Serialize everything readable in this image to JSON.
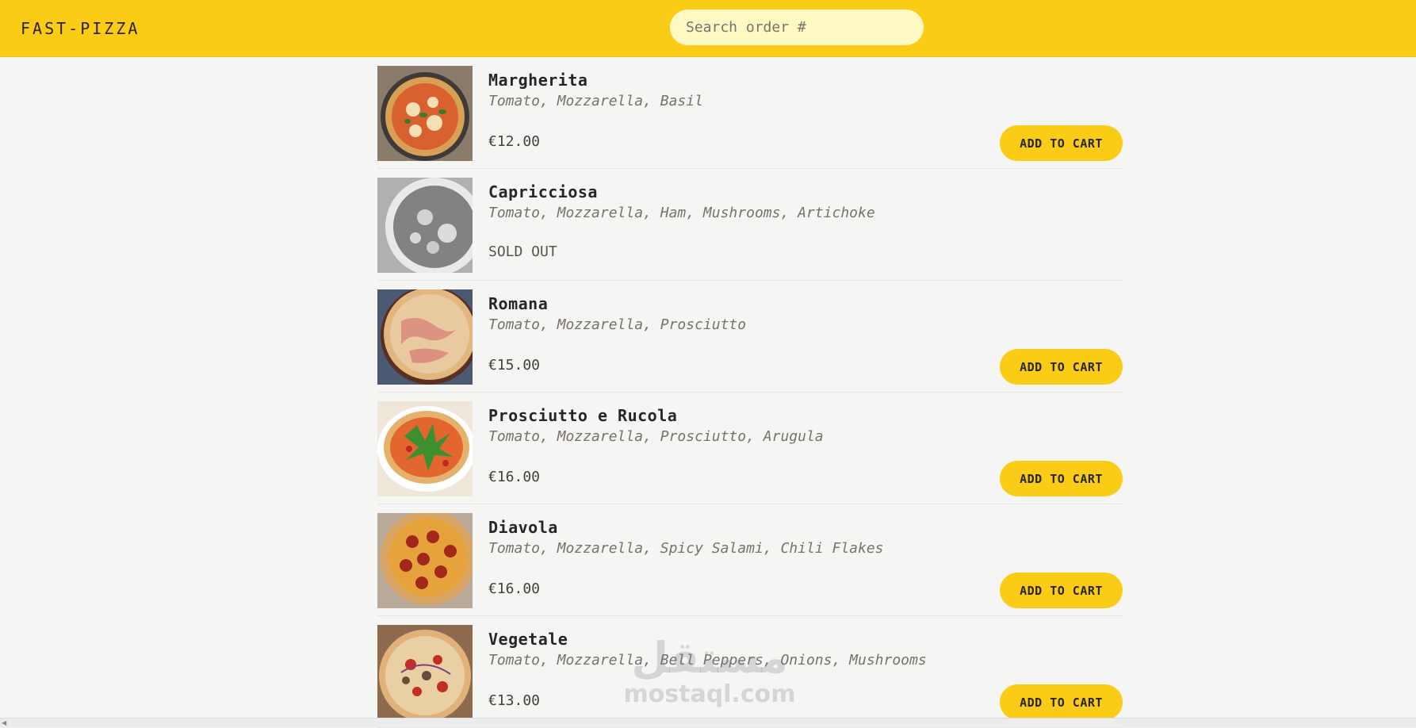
{
  "header": {
    "logo": "FAST-PIZZA",
    "search_placeholder": "Search order #"
  },
  "colors": {
    "accent": "#facc15",
    "search_bg": "#fef9c3",
    "page_bg": "#f5f5f4"
  },
  "menu": [
    {
      "name": "Margherita",
      "ingredients": "Tomato, Mozzarella, Basil",
      "price": "€12.00",
      "sold_out": false,
      "button": "ADD TO CART"
    },
    {
      "name": "Capricciosa",
      "ingredients": "Tomato, Mozzarella, Ham, Mushrooms, Artichoke",
      "status": "SOLD OUT",
      "sold_out": true
    },
    {
      "name": "Romana",
      "ingredients": "Tomato, Mozzarella, Prosciutto",
      "price": "€15.00",
      "sold_out": false,
      "button": "ADD TO CART"
    },
    {
      "name": "Prosciutto e Rucola",
      "ingredients": "Tomato, Mozzarella, Prosciutto, Arugula",
      "price": "€16.00",
      "sold_out": false,
      "button": "ADD TO CART"
    },
    {
      "name": "Diavola",
      "ingredients": "Tomato, Mozzarella, Spicy Salami, Chili Flakes",
      "price": "€16.00",
      "sold_out": false,
      "button": "ADD TO CART"
    },
    {
      "name": "Vegetale",
      "ingredients": "Tomato, Mozzarella, Bell Peppers, Onions, Mushrooms",
      "price": "€13.00",
      "sold_out": false,
      "button": "ADD TO CART"
    }
  ],
  "watermark": {
    "mark": "مستقل",
    "text": "mostaql.com"
  }
}
